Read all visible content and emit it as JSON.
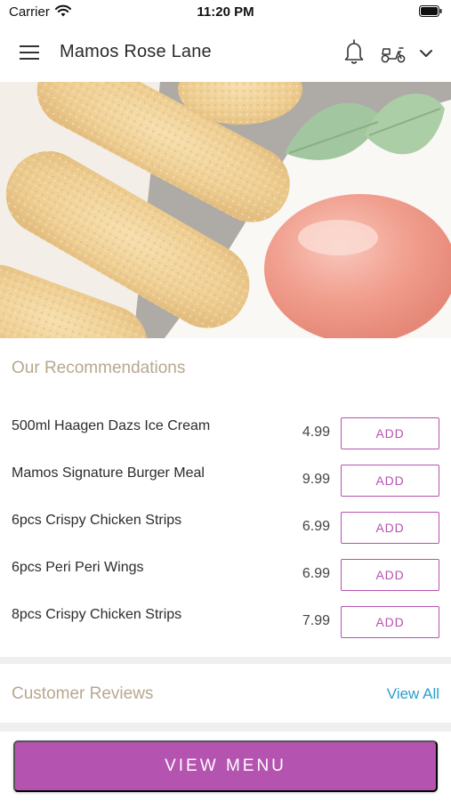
{
  "status_bar": {
    "carrier": "Carrier",
    "time": "11:20 PM"
  },
  "header": {
    "title": "Mamos Rose Lane",
    "menu_icon": "hamburger-menu-icon",
    "notification_icon": "bell-icon",
    "delivery_icon": "scooter-icon",
    "dropdown_icon": "chevron-down-icon"
  },
  "hero": {
    "image": "crispy-chicken-strips-with-ketchup"
  },
  "recommendations": {
    "heading": "Our Recommendations",
    "items": [
      {
        "name": "500ml Haagen Dazs Ice Cream",
        "price": "4.99",
        "add_label": "ADD"
      },
      {
        "name": "Mamos Signature Burger Meal",
        "price": "9.99",
        "add_label": "ADD"
      },
      {
        "name": "6pcs Crispy Chicken Strips",
        "price": "6.99",
        "add_label": "ADD"
      },
      {
        "name": "6pcs Peri Peri Wings",
        "price": "6.99",
        "add_label": "ADD"
      },
      {
        "name": "8pcs Crispy Chicken Strips",
        "price": "7.99",
        "add_label": "ADD"
      }
    ]
  },
  "reviews": {
    "heading": "Customer Reviews",
    "view_all_label": "View All"
  },
  "footer": {
    "view_menu_label": "VIEW MENU"
  },
  "colors": {
    "accent": "#b553b0",
    "heading": "#b7a88f",
    "link": "#2a9fc7"
  }
}
